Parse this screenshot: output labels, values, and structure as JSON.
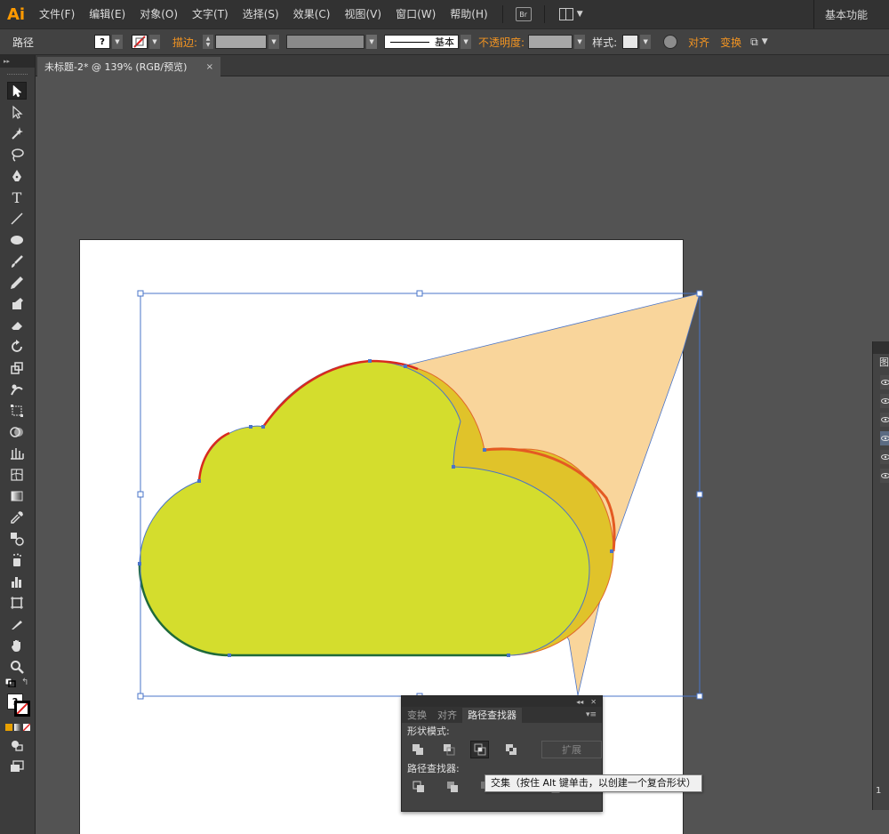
{
  "app": {
    "logo": "Ai",
    "workspace": "基本功能"
  },
  "menu": [
    "文件(F)",
    "编辑(E)",
    "对象(O)",
    "文字(T)",
    "选择(S)",
    "效果(C)",
    "视图(V)",
    "窗口(W)",
    "帮助(H)"
  ],
  "menu_extra": {
    "bridge": "Br"
  },
  "control": {
    "selection_label": "路径",
    "fill_symbol": "?",
    "stroke_label": "描边:",
    "stroke_style": "基本",
    "opacity_label": "不透明度:",
    "style_label": "样式:",
    "align_label": "对齐",
    "transform_label": "变换"
  },
  "document": {
    "tab_title": "未标题-2* @ 139% (RGB/预览)",
    "close": "×"
  },
  "toolbar": {
    "collapse": "▸▸",
    "fill_stroke_symbol": "?"
  },
  "layers_panel": {
    "title_char": "图",
    "footer": "1"
  },
  "pathfinder": {
    "tabs": [
      "变换",
      "对齐",
      "路径查找器"
    ],
    "active_tab": "路径查找器",
    "shape_modes_label": "形状模式:",
    "expand_label": "扩展",
    "pathfinders_label": "路径查找器:",
    "tooltip": "交集（按住 Alt 键单击，以创建一个复合形状）"
  },
  "colors": {
    "cloud_front": "#d4dd2d",
    "cloud_back": "#e0c32a",
    "beam": "#f9d59b",
    "stroke_red": "#d82a1e",
    "stroke_green": "#1f6a3a",
    "selection": "#4a74c8",
    "accent_orange": "#f29422"
  }
}
